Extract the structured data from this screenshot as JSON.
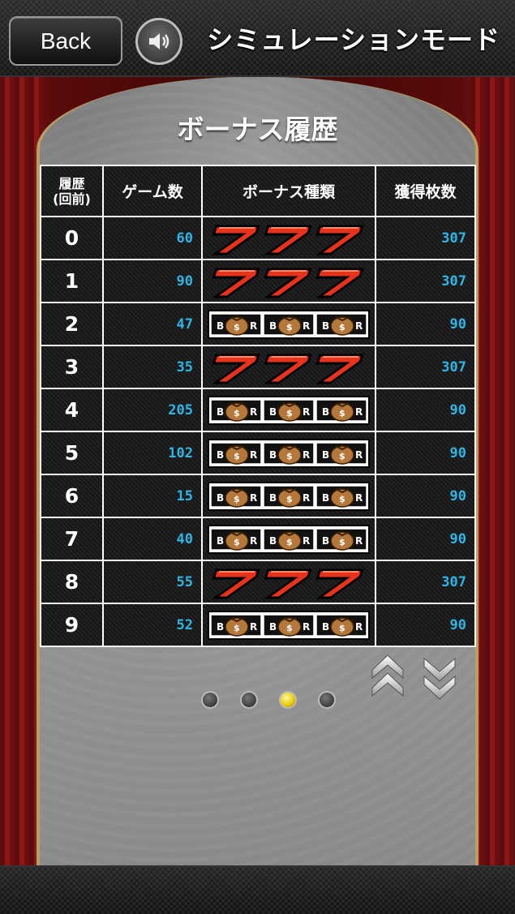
{
  "header": {
    "back_label": "Back",
    "mode_title": "シミュレーションモード",
    "sound_icon": "speaker-icon"
  },
  "main": {
    "title": "ボーナス履歴",
    "columns": [
      "履歴\n(回前)",
      "ゲーム数",
      "ボーナス種類",
      "獲得枚数"
    ],
    "rows": [
      {
        "index": "0",
        "games": "60",
        "bonus": "777",
        "coins": "307"
      },
      {
        "index": "1",
        "games": "90",
        "bonus": "777",
        "coins": "307"
      },
      {
        "index": "2",
        "games": "47",
        "bonus": "BAR",
        "coins": "90"
      },
      {
        "index": "3",
        "games": "35",
        "bonus": "777",
        "coins": "307"
      },
      {
        "index": "4",
        "games": "205",
        "bonus": "BAR",
        "coins": "90"
      },
      {
        "index": "5",
        "games": "102",
        "bonus": "BAR",
        "coins": "90"
      },
      {
        "index": "6",
        "games": "15",
        "bonus": "BAR",
        "coins": "90"
      },
      {
        "index": "7",
        "games": "40",
        "bonus": "BAR",
        "coins": "90"
      },
      {
        "index": "8",
        "games": "55",
        "bonus": "777",
        "coins": "307"
      },
      {
        "index": "9",
        "games": "52",
        "bonus": "BAR",
        "coins": "90"
      }
    ],
    "pagination": {
      "pages": 4,
      "current": 3
    },
    "colors": {
      "value_text": "#2db7e6",
      "seven_red": "#e8321c",
      "active_dot": "#e6c800"
    }
  }
}
